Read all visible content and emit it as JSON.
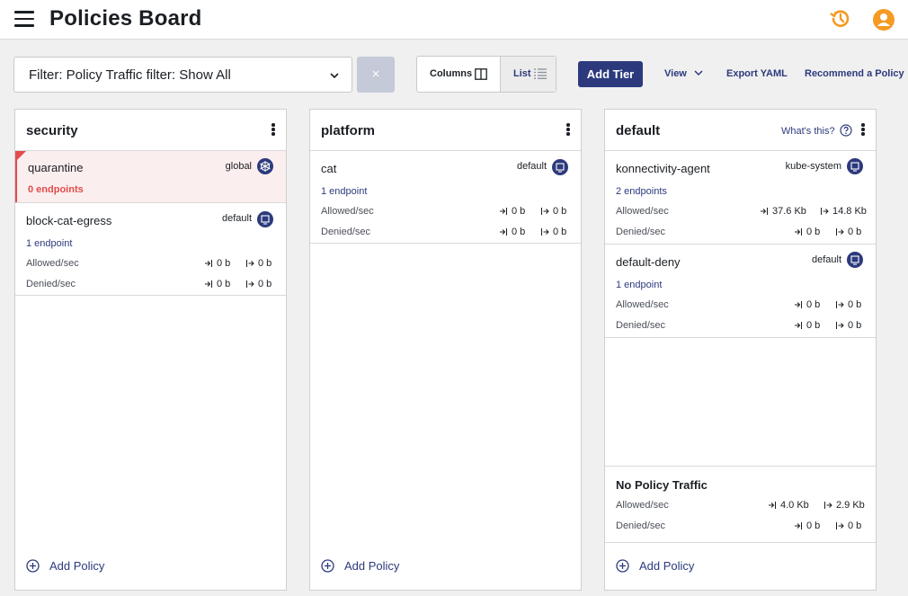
{
  "header": {
    "title": "Policies Board"
  },
  "toolbar": {
    "filter_value": "Filter: Policy Traffic filter: Show All",
    "clear_label": "×",
    "columns_label": "Columns",
    "list_label": "List",
    "add_tier_label": "Add Tier",
    "view_label": "View",
    "export_label": "Export YAML",
    "recommend_label": "Recommend a Policy"
  },
  "tiers": [
    {
      "name": "security",
      "add_policy_label": "Add Policy",
      "policies": [
        {
          "name": "quarantine",
          "namespace": "global",
          "endpoints": "0 endpoints"
        },
        {
          "name": "block-cat-egress",
          "namespace": "default",
          "endpoints": "1 endpoint",
          "allowed_label": "Allowed/sec",
          "allowed_in": "0 b",
          "allowed_out": "0 b",
          "denied_label": "Denied/sec",
          "denied_in": "0 b",
          "denied_out": "0 b"
        }
      ]
    },
    {
      "name": "platform",
      "add_policy_label": "Add Policy",
      "policies": [
        {
          "name": "cat",
          "namespace": "default",
          "endpoints": "1 endpoint",
          "allowed_label": "Allowed/sec",
          "allowed_in": "0 b",
          "allowed_out": "0 b",
          "denied_label": "Denied/sec",
          "denied_in": "0 b",
          "denied_out": "0 b"
        }
      ]
    },
    {
      "name": "default",
      "whats_this": "What's this?",
      "add_policy_label": "Add Policy",
      "policies": [
        {
          "name": "konnectivity-agent",
          "namespace": "kube-system",
          "endpoints": "2 endpoints",
          "allowed_label": "Allowed/sec",
          "allowed_in": "37.6 Kb",
          "allowed_out": "14.8 Kb",
          "denied_label": "Denied/sec",
          "denied_in": "0 b",
          "denied_out": "0 b"
        },
        {
          "name": "default-deny",
          "namespace": "default",
          "endpoints": "1 endpoint",
          "allowed_label": "Allowed/sec",
          "allowed_in": "0 b",
          "allowed_out": "0 b",
          "denied_label": "Denied/sec",
          "denied_in": "0 b",
          "denied_out": "0 b"
        }
      ],
      "no_policy_traffic": {
        "title": "No Policy Traffic",
        "allowed_label": "Allowed/sec",
        "allowed_in": "4.0 Kb",
        "allowed_out": "2.9 Kb",
        "denied_label": "Denied/sec",
        "denied_in": "0 b",
        "denied_out": "0 b"
      }
    }
  ],
  "colors": {
    "accent": "#2c3a7d",
    "orange": "#f59a23",
    "danger": "#e34c4c"
  }
}
